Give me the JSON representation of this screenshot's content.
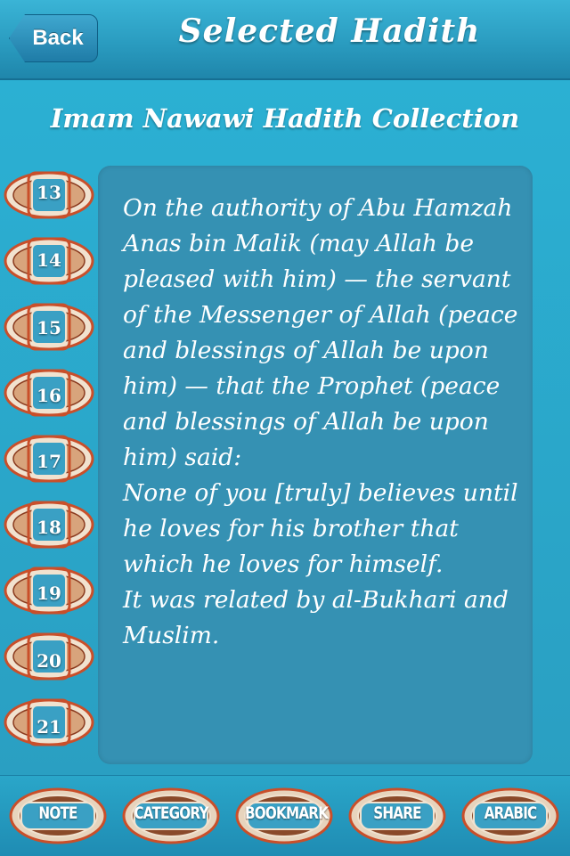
{
  "header": {
    "back_label": "Back",
    "title": "Selected Hadith"
  },
  "collection_title": "Imam Nawawi Hadith Collection",
  "hadith": {
    "text": "On the authority of Abu Hamzah Anas bin Malik (may Allah be pleased with him) — the servant of the Messenger of Allah (peace and blessings of Allah be upon him) — that the Prophet (peace and blessings of Allah be upon him) said:\nNone of you [truly] believes until he loves for his brother that which he loves for himself.\nIt was related by al-Bukhari and Muslim."
  },
  "hadith_numbers": [
    "13",
    "14",
    "15",
    "16",
    "17",
    "18",
    "19",
    "20",
    "21"
  ],
  "toolbar": {
    "note": "NOTE",
    "category": "CATEGORY",
    "bookmark": "BOOKMARK",
    "share": "SHARE",
    "arabic": "ARABIC"
  },
  "colors": {
    "background": "#2a9fbf",
    "panel": "#3591b3",
    "ornament_fill": "#f1e2cf",
    "ornament_stroke": "#c94f2a"
  }
}
